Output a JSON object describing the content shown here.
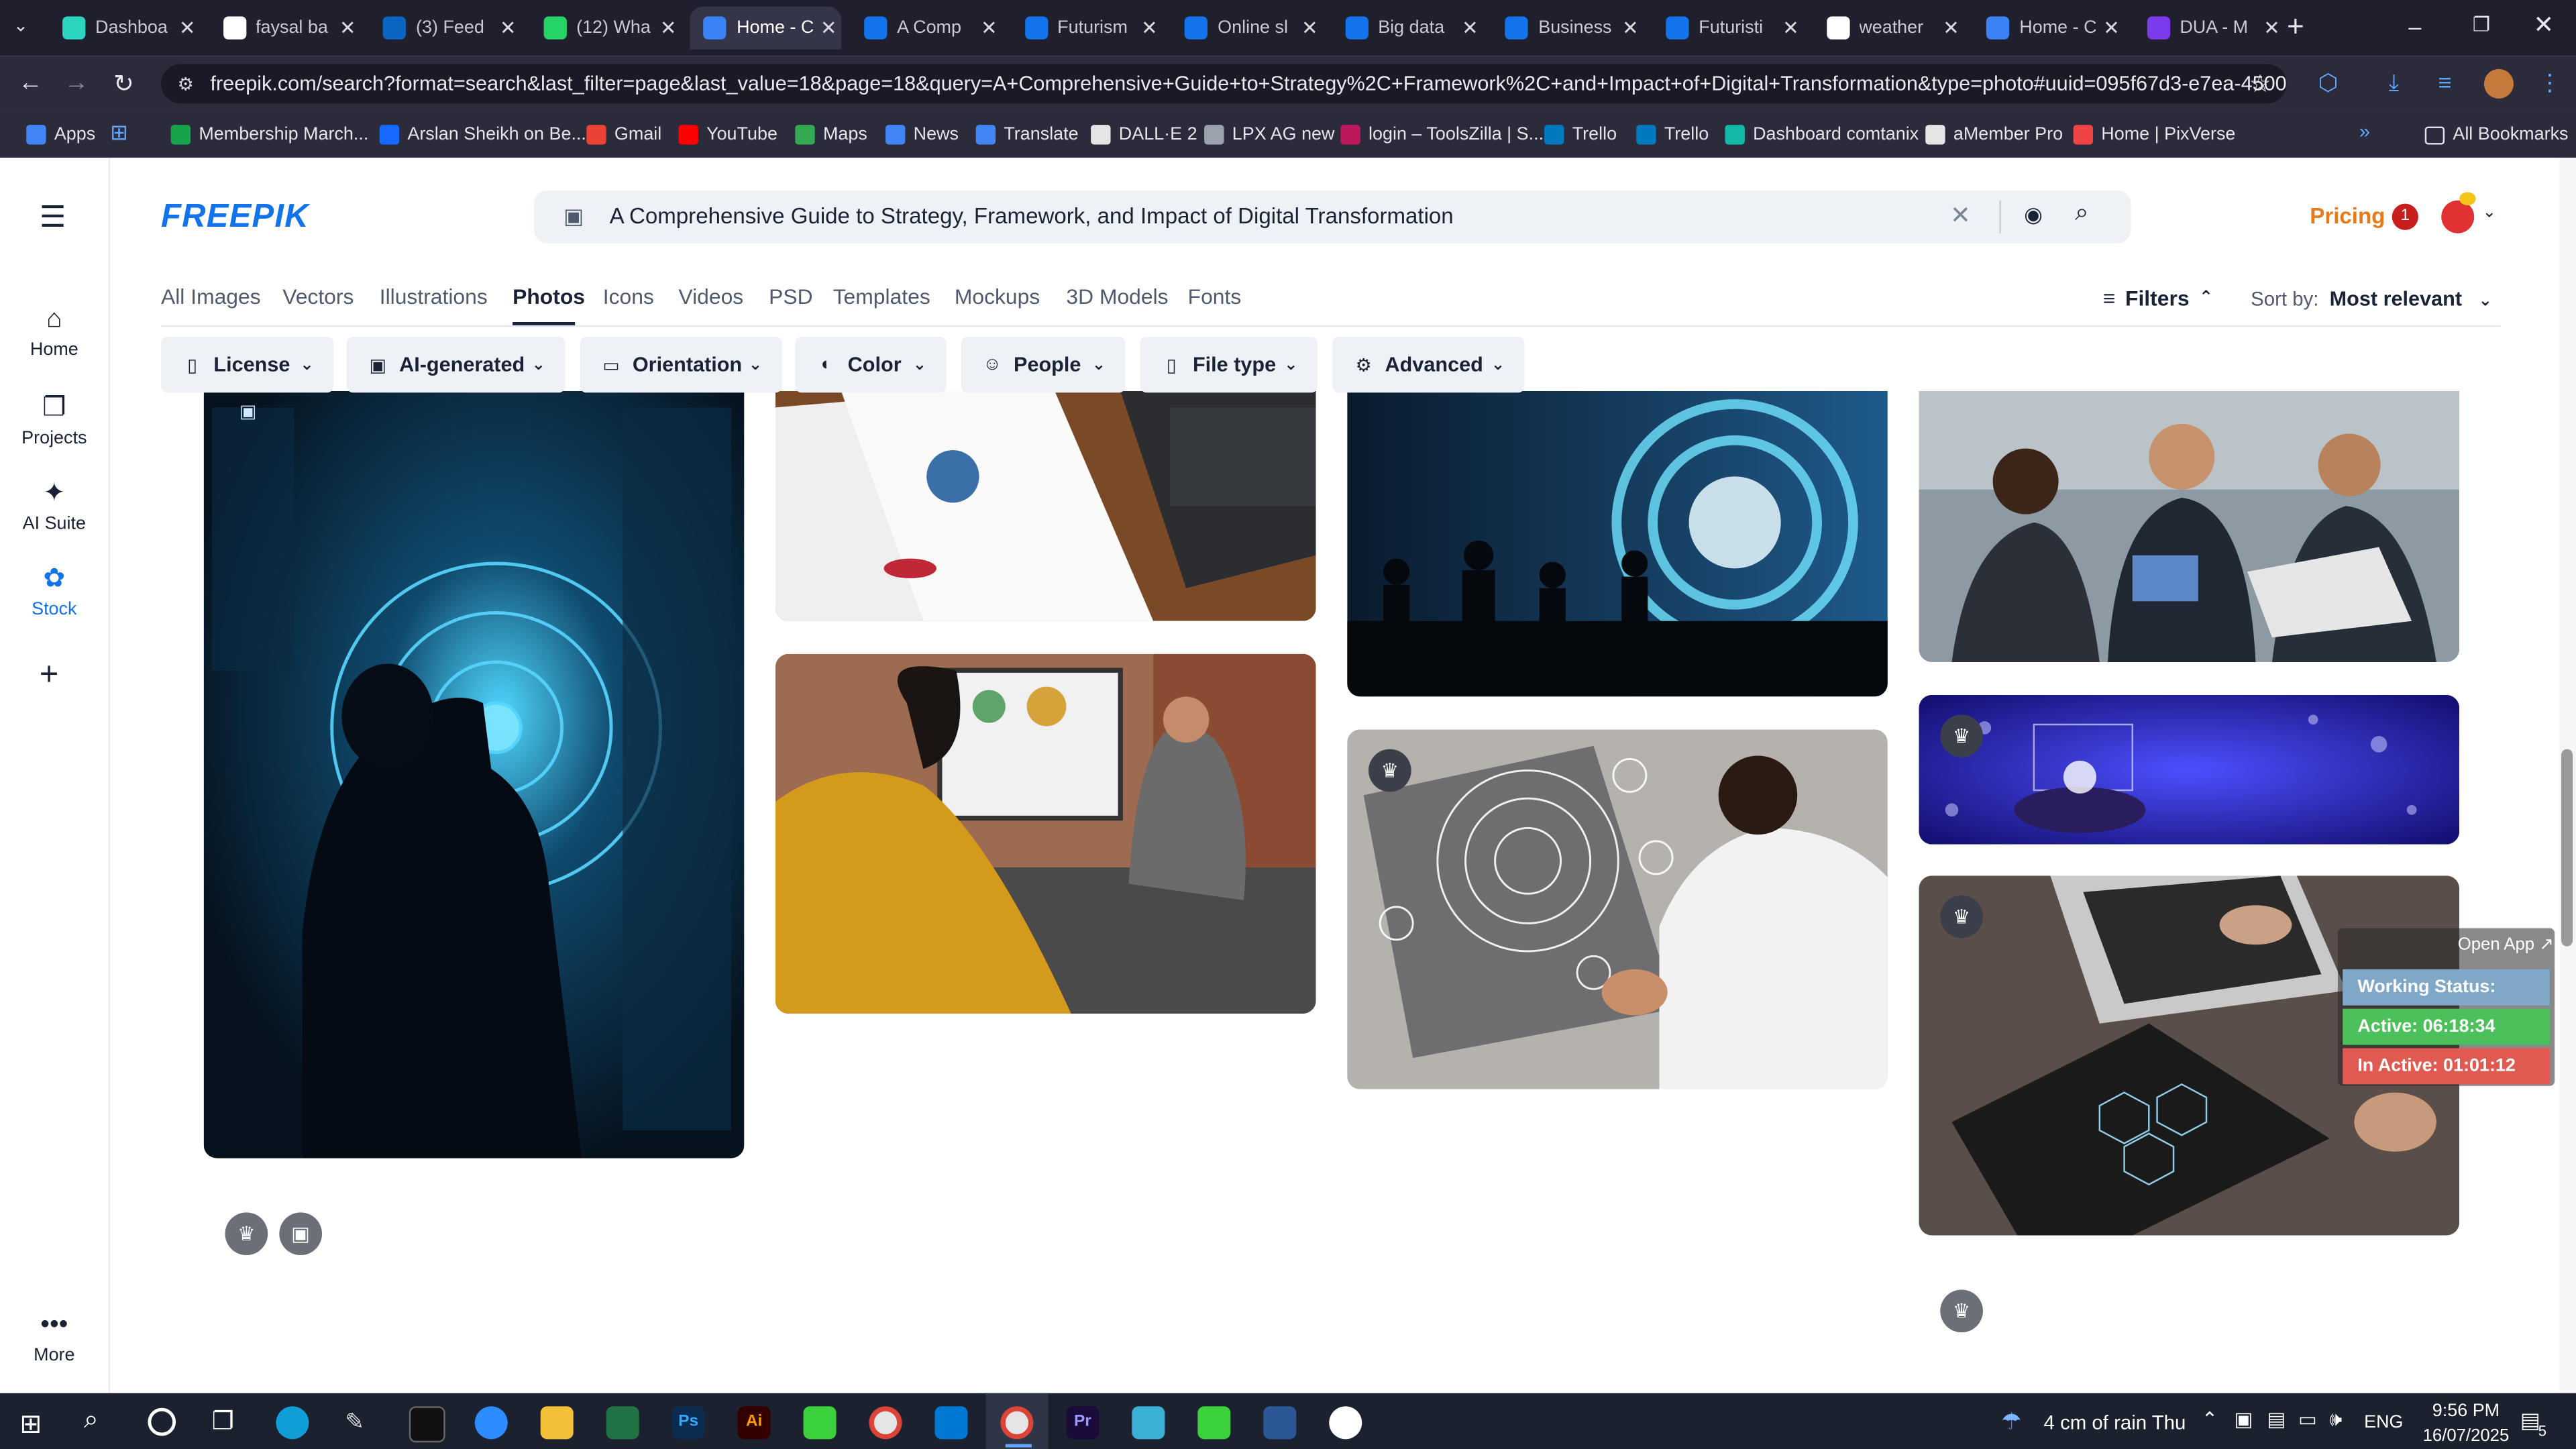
{
  "browser": {
    "tabs": [
      {
        "title": "Dashboa",
        "color": "#2dd4bf"
      },
      {
        "title": "faysal ba",
        "color": "#ffffff"
      },
      {
        "title": "(3) Feed",
        "color": "#0a66c2"
      },
      {
        "title": "(12) Wha",
        "color": "#25d366"
      },
      {
        "title": "Home - C",
        "color": "#3b82f6"
      },
      {
        "title": "A Comp",
        "color": "#1273eb"
      },
      {
        "title": "Futurism",
        "color": "#1273eb"
      },
      {
        "title": "Online sl",
        "color": "#1273eb"
      },
      {
        "title": "Big data",
        "color": "#1273eb"
      },
      {
        "title": "Business",
        "color": "#1273eb"
      },
      {
        "title": "Futuristi",
        "color": "#1273eb"
      },
      {
        "title": "weather",
        "color": "#ffffff"
      },
      {
        "title": "Home - C",
        "color": "#3b82f6"
      },
      {
        "title": "DUA - M",
        "color": "#7c3aed"
      }
    ],
    "url": "freepik.com/search?format=search&last_filter=page&last_value=18&page=18&query=A+Comprehensive+Guide+to+Strategy%2C+Framework%2C+and+Impact+of+Digital+Transformation&type=photo#uuid=095f67d3-e7ea-4500-be7d-a4...",
    "bookmarks": [
      {
        "label": "Apps",
        "color": "#4285f4"
      },
      {
        "label": "Membership March...",
        "color": "#16a34a"
      },
      {
        "label": "Arslan Sheikh on Be...",
        "color": "#1769ff"
      },
      {
        "label": "Gmail",
        "color": "#ea4335"
      },
      {
        "label": "YouTube",
        "color": "#ff0000"
      },
      {
        "label": "Maps",
        "color": "#34a853"
      },
      {
        "label": "News",
        "color": "#4285f4"
      },
      {
        "label": "Translate",
        "color": "#4285f4"
      },
      {
        "label": "DALL·E 2",
        "color": "#e5e5e5"
      },
      {
        "label": "LPX AG new",
        "color": "#9ca3af"
      },
      {
        "label": "login – ToolsZilla | S...",
        "color": "#be185d"
      },
      {
        "label": "Trello",
        "color": "#0079bf"
      },
      {
        "label": "Trello",
        "color": "#0079bf"
      },
      {
        "label": "Dashboard comtanix",
        "color": "#14b8a6"
      },
      {
        "label": "aMember Pro",
        "color": "#e5e5e5"
      },
      {
        "label": "Home | PixVerse",
        "color": "#ef4444"
      }
    ],
    "all_bookmarks": "All Bookmarks"
  },
  "site": {
    "logo": "FREEPIK",
    "search_query": "A Comprehensive Guide to Strategy, Framework, and Impact of Digital Transformation",
    "pricing": "Pricing",
    "notification_count": "1",
    "nav": {
      "home": "Home",
      "projects": "Projects",
      "ai_suite": "AI Suite",
      "stock": "Stock",
      "more": "More"
    },
    "categories": [
      "All Images",
      "Vectors",
      "Illustrations",
      "Photos",
      "Icons",
      "Videos",
      "PSD",
      "Templates",
      "Mockups",
      "3D Models",
      "Fonts"
    ],
    "active_category": "Photos",
    "filters_label": "Filters",
    "sort_label": "Sort by:",
    "sort_value": "Most relevant",
    "filter_buttons": [
      "License",
      "AI-generated",
      "Orientation",
      "Color",
      "People",
      "File type",
      "Advanced"
    ]
  },
  "overlay": {
    "open_app": "Open App ↗",
    "working_status": "Working Status: Active",
    "active_time": "Active: 06:18:34",
    "inactive_time": "In Active: 01:01:12"
  },
  "taskbar": {
    "weather": "4 cm of rain Thu",
    "language": "ENG",
    "time": "9:56 PM",
    "date": "16/07/2025",
    "notifications": "5"
  }
}
